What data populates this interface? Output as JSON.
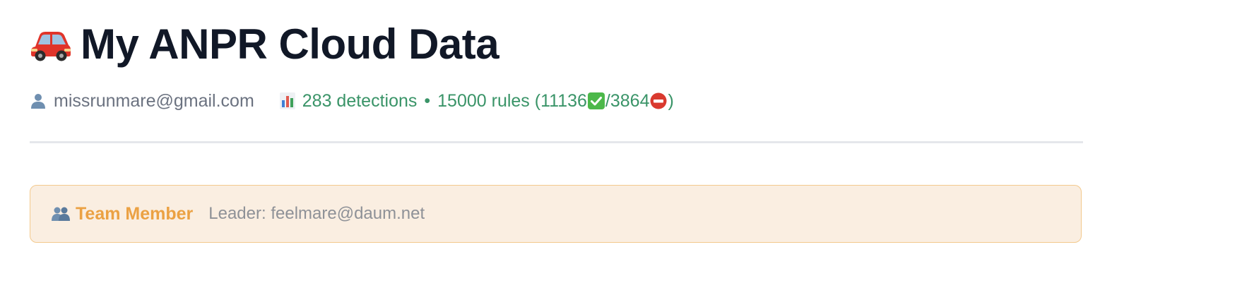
{
  "header": {
    "title": "My ANPR Cloud Data",
    "title_icon": "car-icon"
  },
  "meta": {
    "user_icon": "user-icon",
    "email": "missrunmare@gmail.com",
    "stats_icon": "bar-chart-icon",
    "detections": "283 detections",
    "separator": "•",
    "rules_prefix": "15000 rules (",
    "allowed_count": "11136",
    "allowed_icon": "check-mark-icon",
    "slash": "/",
    "blocked_count": "3864",
    "blocked_icon": "no-entry-icon",
    "rules_suffix": ")"
  },
  "team": {
    "icon": "team-icon",
    "role": "Team Member",
    "leader": "Leader: feelmare@daum.net"
  },
  "colors": {
    "title": "#111827",
    "email": "#6b7280",
    "stats": "#3a9468",
    "team_role": "#eba143",
    "team_bg": "#faeee1",
    "team_border": "#f3c98d"
  }
}
